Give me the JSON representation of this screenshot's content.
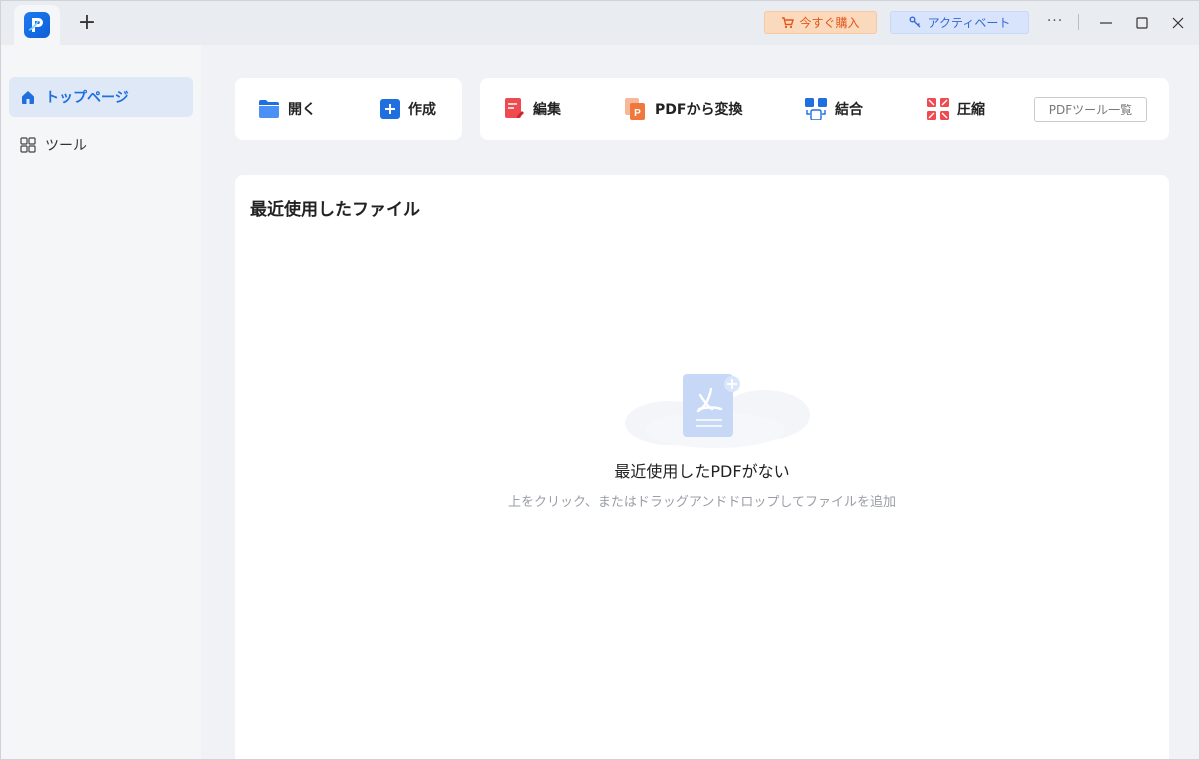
{
  "titlebar": {
    "new_tab_label": "+",
    "buy_label": "今すぐ購入",
    "activate_label": "アクティベート",
    "more_label": "···"
  },
  "sidebar": {
    "items": [
      {
        "label": "トップページ",
        "icon": "home-icon",
        "active": true
      },
      {
        "label": "ツール",
        "icon": "grid-icon",
        "active": false
      }
    ]
  },
  "actions": {
    "open_label": "開く",
    "create_label": "作成",
    "edit_label": "編集",
    "convert_label": "PDFから変換",
    "merge_label": "結合",
    "compress_label": "圧縮",
    "tools_list_label": "PDFツール一覧"
  },
  "recent": {
    "title": "最近使用したファイル",
    "empty_title": "最近使用したPDFがない",
    "empty_hint": "上をクリック、またはドラッグアンドドロップしてファイルを追加"
  },
  "colors": {
    "accent": "#1f6fe0",
    "buy": "#e4561a",
    "activate": "#3568d4",
    "edit_red": "#ef4a50",
    "convert_orange": "#f0783c"
  }
}
